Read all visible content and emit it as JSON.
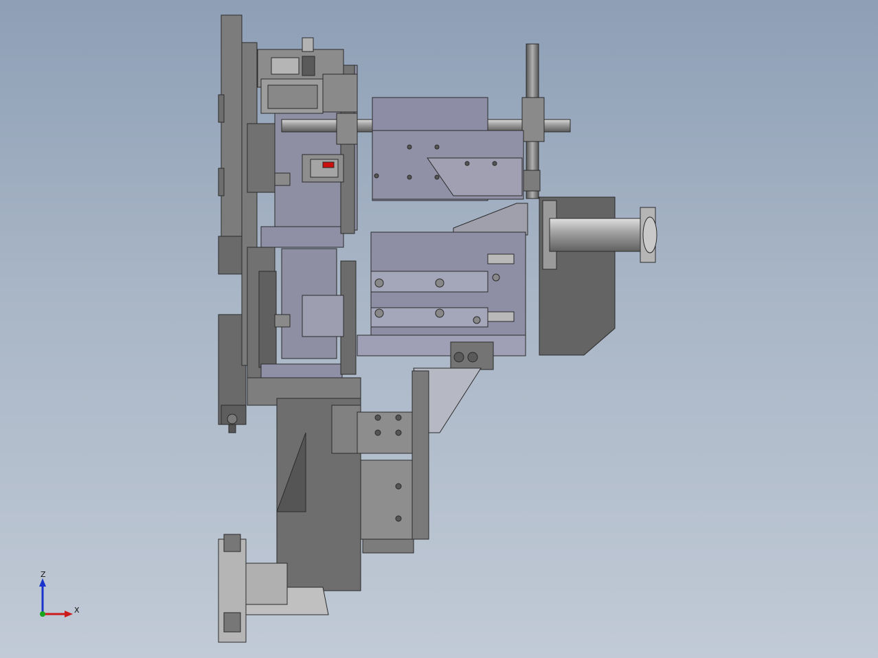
{
  "viewport": {
    "background_top": "#8e9fb6",
    "background_bottom": "#c1cad6"
  },
  "triad": {
    "z_label": "Z",
    "x_label": "X",
    "z_color": "#1a33cc",
    "x_color": "#cc1a1a",
    "y_color": "#1aa61a"
  },
  "model": {
    "name": "machine-assembly-side-view",
    "accent_red": "#cc1010",
    "steel_dark": "#5c5c5c",
    "steel_mid": "#8a8a8a",
    "steel_light": "#b4b4b4",
    "anodized_blue": "#8b8ea6"
  }
}
